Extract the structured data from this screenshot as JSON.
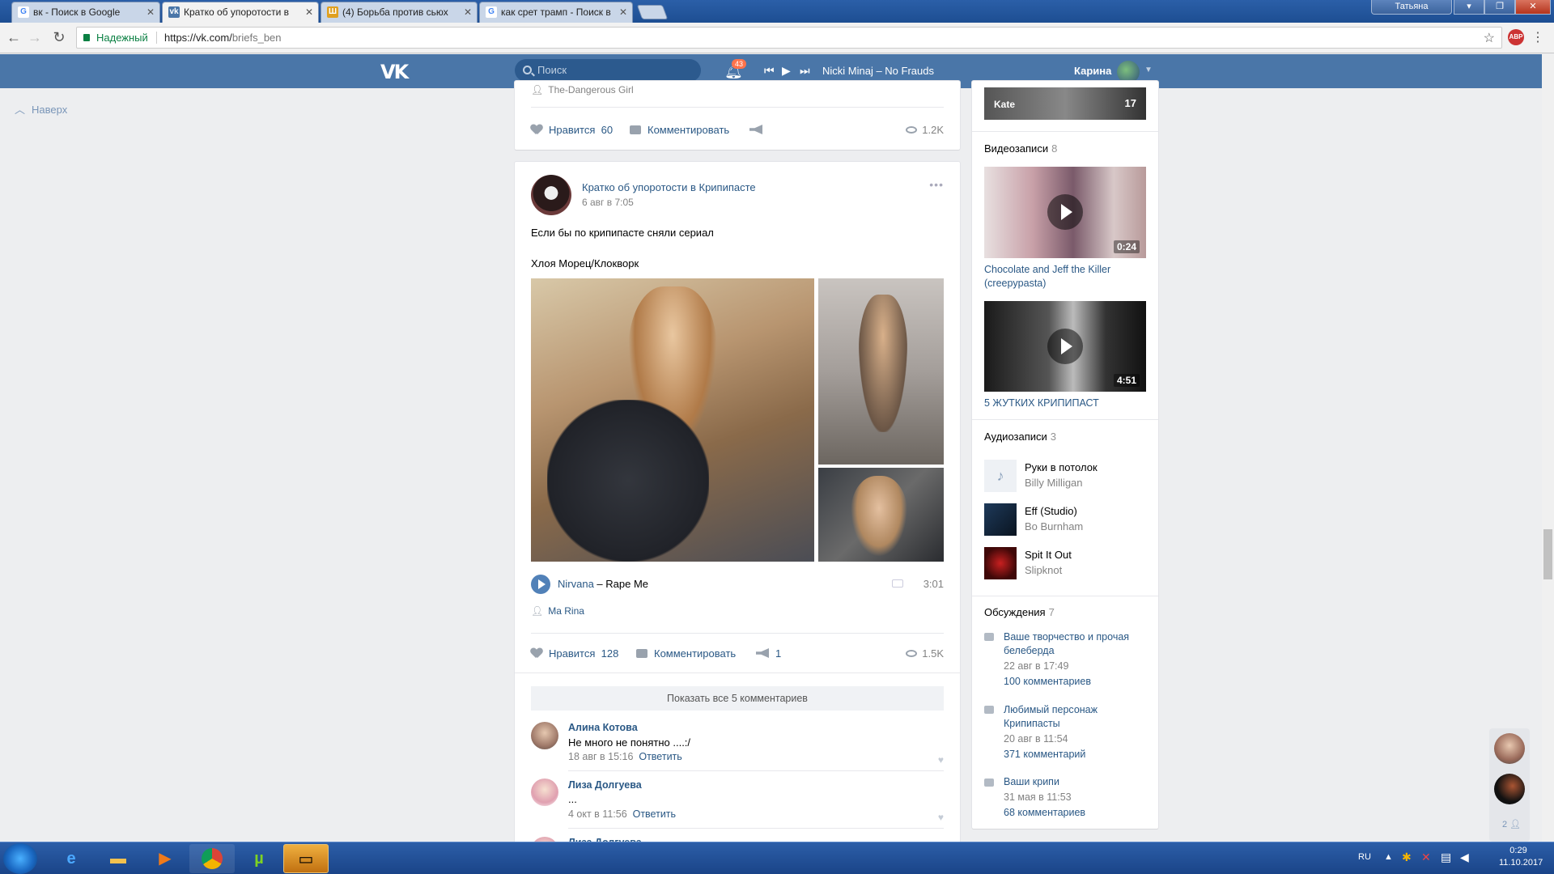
{
  "browser": {
    "tabs": [
      {
        "title": "вк - Поиск в Google",
        "fav": "G"
      },
      {
        "title": "Кратко об упоротости в",
        "fav": "vk"
      },
      {
        "title": "(4) Борьба против сьюх",
        "fav": "Ш"
      },
      {
        "title": "как срет трамп - Поиск в",
        "fav": "G"
      }
    ],
    "user_chip": "Татьяна",
    "secure_label": "Надежный",
    "url_host": "https://vk.com/",
    "url_path": "briefs_ben"
  },
  "vk_header": {
    "logo": "vk",
    "search_placeholder": "Поиск",
    "notif_count": "43",
    "now_playing": "Nicki Minaj – No Frauds",
    "user_name": "Карина"
  },
  "left": {
    "back_to_top": "Наверх"
  },
  "prev_post": {
    "author_line": "The-Dangerous Girl",
    "like_label": "Нравится",
    "like_count": "60",
    "comment_label": "Комментировать",
    "views": "1.2K"
  },
  "post": {
    "group_name": "Кратко об упоротости в Крипипасте",
    "date": "6 авг в 7:05",
    "text1": "Если бы по крипипасте сняли сериал",
    "text2": "Хлоя Морец/Клокворк",
    "audio_artist": "Nirvana",
    "audio_dash": "–",
    "audio_title": "Rape Me",
    "audio_duration": "3:01",
    "author": "Ma Rina",
    "like_label": "Нравится",
    "like_count": "128",
    "comment_label": "Комментировать",
    "share_count": "1",
    "views": "1.5K",
    "show_all_comments": "Показать все 5 комментариев",
    "comments": [
      {
        "name": "Алина Котова",
        "text": "Не много не понятно ....:/",
        "date": "18 авг в 15:16",
        "reply": "Ответить"
      },
      {
        "name": "Лиза Долгуева",
        "text": "...",
        "date": "4 окт в 11:56",
        "reply": "Ответить"
      },
      {
        "name": "Лиза Долгуева"
      }
    ]
  },
  "sidebar": {
    "top_thumb_label": "Kate",
    "top_thumb_count": "17",
    "videos_title": "Видеозаписи",
    "videos_count": "8",
    "videos": [
      {
        "title": "Chocolate and Jeff the Killer (creepypasta)",
        "duration": "0:24"
      },
      {
        "title": "5 ЖУТКИХ КРИПИПАСТ",
        "duration": "4:51"
      }
    ],
    "audio_title": "Аудиозаписи",
    "audio_count": "3",
    "audios": [
      {
        "title": "Руки в потолок",
        "artist": "Billy Milligan"
      },
      {
        "title": "Eff (Studio)",
        "artist": "Bo Burnham"
      },
      {
        "title": "Spit It Out",
        "artist": "Slipknot"
      }
    ],
    "discussions_title": "Обсуждения",
    "discussions_count": "7",
    "discussions": [
      {
        "title": "Ваше творчество и прочая белеберда",
        "date": "22 авг в 17:49",
        "comments": "100 комментариев"
      },
      {
        "title": "Любимый персонаж Крипипасты",
        "date": "20 авг в 11:54",
        "comments": "371 комментарий"
      },
      {
        "title": "Ваши крипи",
        "date": "31 мая в 11:53",
        "comments": "68 комментариев"
      }
    ]
  },
  "chat": {
    "count": "2"
  },
  "taskbar": {
    "lang": "RU",
    "time": "0:29",
    "date": "11.10.2017"
  }
}
